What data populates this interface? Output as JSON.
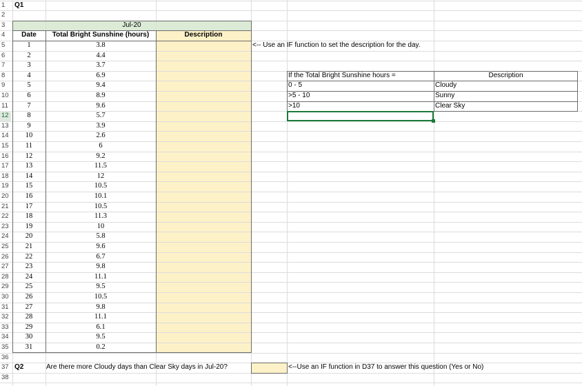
{
  "row_numbers": [
    "1",
    "2",
    "3",
    "4",
    "5",
    "6",
    "7",
    "8",
    "9",
    "10",
    "11",
    "12",
    "13",
    "14",
    "15",
    "16",
    "17",
    "18",
    "19",
    "20",
    "21",
    "22",
    "23",
    "24",
    "25",
    "26",
    "27",
    "28",
    "29",
    "30",
    "31",
    "32",
    "33",
    "34",
    "35",
    "36",
    "37",
    "38"
  ],
  "q1_label": "Q1",
  "q2_label": "Q2",
  "month_header": "Jul-20",
  "headers": {
    "date": "Date",
    "sunshine": "Total Bright Sunshine (hours)",
    "description": "Description"
  },
  "rows": [
    {
      "date": "1",
      "hours": "3.8"
    },
    {
      "date": "2",
      "hours": "4.4"
    },
    {
      "date": "3",
      "hours": "3.7"
    },
    {
      "date": "4",
      "hours": "6.9"
    },
    {
      "date": "5",
      "hours": "9.4"
    },
    {
      "date": "6",
      "hours": "8.9"
    },
    {
      "date": "7",
      "hours": "9.6"
    },
    {
      "date": "8",
      "hours": "5.7"
    },
    {
      "date": "9",
      "hours": "3.9"
    },
    {
      "date": "10",
      "hours": "2.6"
    },
    {
      "date": "11",
      "hours": "6"
    },
    {
      "date": "12",
      "hours": "9.2"
    },
    {
      "date": "13",
      "hours": "11.5"
    },
    {
      "date": "14",
      "hours": "12"
    },
    {
      "date": "15",
      "hours": "10.5"
    },
    {
      "date": "16",
      "hours": "10.1"
    },
    {
      "date": "17",
      "hours": "10.5"
    },
    {
      "date": "18",
      "hours": "11.3"
    },
    {
      "date": "19",
      "hours": "10"
    },
    {
      "date": "20",
      "hours": "5.8"
    },
    {
      "date": "21",
      "hours": "9.6"
    },
    {
      "date": "22",
      "hours": "6.7"
    },
    {
      "date": "23",
      "hours": "9.8"
    },
    {
      "date": "24",
      "hours": "11.1"
    },
    {
      "date": "25",
      "hours": "9.5"
    },
    {
      "date": "26",
      "hours": "10.5"
    },
    {
      "date": "27",
      "hours": "9.8"
    },
    {
      "date": "28",
      "hours": "11.1"
    },
    {
      "date": "29",
      "hours": "6.1"
    },
    {
      "date": "30",
      "hours": "9.5"
    },
    {
      "date": "31",
      "hours": "0.2"
    }
  ],
  "instruction_q1": "<-- Use an IF function to set the description for the day.",
  "lookup": {
    "header_condition": "If the Total Bright Sunshine hours =",
    "header_description": "Description",
    "entries": [
      {
        "range": "0 - 5",
        "label": "Cloudy"
      },
      {
        "range": ">5 - 10",
        "label": "Sunny"
      },
      {
        "range": ">10",
        "label": "Clear Sky"
      }
    ]
  },
  "question_q2": "Are there more Cloudy days than Clear Sky days in Jul-20?",
  "instruction_q2": "<--Use an IF function in D37 to answer this question (Yes or No)",
  "colors": {
    "answer_fill": "#fdf1c7",
    "header_fill": "#dcebd6",
    "selection": "#1b7a3a",
    "gridline": "#dcdcdc"
  }
}
